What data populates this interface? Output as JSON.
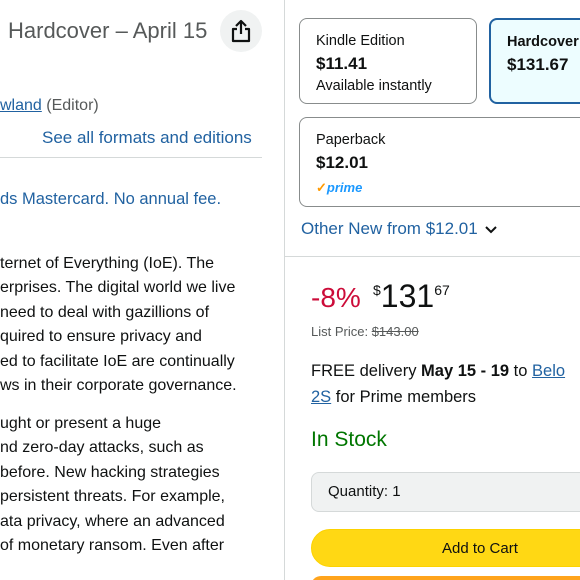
{
  "product": {
    "title": "Hardcover – April 15",
    "byline_link": "wland",
    "byline_role": "(Editor)",
    "formats_link": "See all formats and editions",
    "card_promo": "ds Mastercard. No annual fee.",
    "description_p1": [
      "ternet of Everything (IoE). The",
      "erprises. The digital world we live",
      "need to deal with gazillions of",
      "quired to ensure privacy and",
      "ed to facilitate IoE are continually",
      "ws in their corporate governance."
    ],
    "description_p2": [
      "ught or present a huge",
      "nd zero-day attacks, such as",
      "before. New hacking strategies",
      " persistent threats. For example,",
      "ata privacy, where an advanced",
      "of monetary ransom. Even after"
    ]
  },
  "formats": {
    "kindle": {
      "name": "Kindle Edition",
      "price": "$11.41",
      "note": "Available instantly"
    },
    "hardcover": {
      "name": "Hardcover",
      "price": "$131.67"
    },
    "paperback": {
      "name": "Paperback",
      "price": "$12.01",
      "badge": "prime"
    }
  },
  "offers": {
    "other_new_prefix": "Other New from ",
    "other_new_price": "$12.01"
  },
  "buybox": {
    "discount": "-8%",
    "currency_symbol": "$",
    "price_whole": "131",
    "price_fraction": "67",
    "list_price_label": "List Price: ",
    "list_price": "$143.00",
    "delivery_prefix": "FREE delivery ",
    "delivery_dates": "May 15 - 19",
    "delivery_to": " to ",
    "delivery_location_a": "Belo",
    "delivery_location_b": "2S",
    "delivery_suffix": " for Prime members",
    "stock": "In Stock",
    "quantity_label": "Quantity:",
    "quantity_value": "1",
    "add_to_cart": "Add to Cart"
  },
  "colors": {
    "link": "#2162a1",
    "discount": "#cc0c39",
    "in_stock": "#007600",
    "add_to_cart": "#ffd814",
    "buy_now": "#ffa41c"
  }
}
